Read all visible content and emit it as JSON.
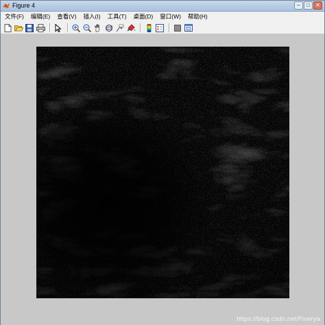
{
  "window": {
    "title": "Figure 4",
    "controls": {
      "minimize": "–",
      "maximize": "□",
      "close": "✕"
    }
  },
  "menubar": {
    "items": [
      {
        "key": "file",
        "label": "文件(F)"
      },
      {
        "key": "edit",
        "label": "编辑(E)"
      },
      {
        "key": "view",
        "label": "查看(V)"
      },
      {
        "key": "insert",
        "label": "插入(I)"
      },
      {
        "key": "tools",
        "label": "工具(T)"
      },
      {
        "key": "desktop",
        "label": "桌面(D)"
      },
      {
        "key": "window",
        "label": "窗口(W)"
      },
      {
        "key": "help",
        "label": "帮助(H)"
      }
    ]
  },
  "toolbar": {
    "buttons": [
      "new-figure-icon",
      "open-file-icon",
      "save-icon",
      "print-icon",
      "pointer-icon",
      "zoom-in-icon",
      "zoom-out-icon",
      "pan-hand-icon",
      "rotate-3d-icon",
      "data-cursor-icon",
      "brush-icon",
      "colorbar-icon",
      "legend-icon",
      "hide-plot-tools-icon",
      "show-plot-tools-icon"
    ]
  },
  "figure": {
    "content": "grayscale image, dark background with faint light texture"
  },
  "watermark": {
    "text": "https://blog.csdn.net/Fiverya"
  }
}
